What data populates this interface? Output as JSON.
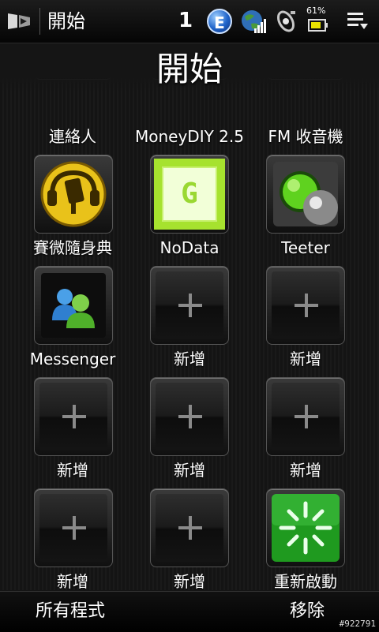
{
  "status_bar": {
    "title": "開始",
    "count": "1",
    "e_icon_letter": "E",
    "battery_percent": "61%"
  },
  "page_title": "開始",
  "tiles": [
    {
      "label": "連絡人",
      "icon": "contacts-icon"
    },
    {
      "label": "MoneyDIY 2.5",
      "icon": "moneydiy-icon"
    },
    {
      "label": "FM 收音機",
      "icon": "fm-radio-icon"
    },
    {
      "label": "賽微隨身典",
      "icon": "dictionary-icon"
    },
    {
      "label": "NoData",
      "icon": "nodata-icon",
      "icon_letter": "G"
    },
    {
      "label": "Teeter",
      "icon": "teeter-icon"
    },
    {
      "label": "Messenger",
      "icon": "messenger-icon"
    },
    {
      "label": "新增",
      "icon": "plus-icon"
    },
    {
      "label": "新增",
      "icon": "plus-icon"
    },
    {
      "label": "新增",
      "icon": "plus-icon"
    },
    {
      "label": "新增",
      "icon": "plus-icon"
    },
    {
      "label": "新增",
      "icon": "plus-icon"
    },
    {
      "label": "新增",
      "icon": "plus-icon"
    },
    {
      "label": "新增",
      "icon": "plus-icon"
    },
    {
      "label": "重新啟動",
      "icon": "restart-icon"
    }
  ],
  "softkeys": {
    "left": "所有程式",
    "right": "移除"
  },
  "watermark": "#922791",
  "colors": {
    "background": "#151515",
    "nodata_green": "#a6e22e",
    "restart_green": "#1f9a1f",
    "teeter_green": "#5fd21f"
  }
}
